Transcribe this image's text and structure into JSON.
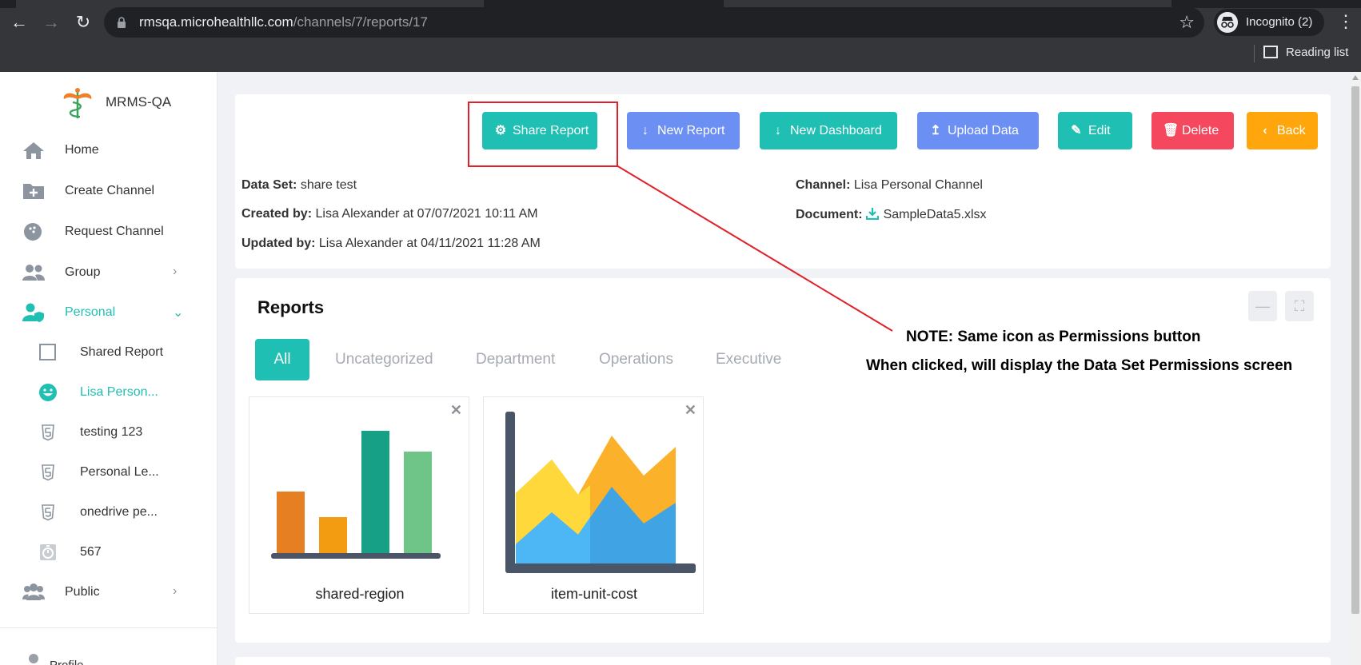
{
  "browser": {
    "url_host": "rmsqa.microhealthllc.com",
    "url_path": "/channels/7/reports/17",
    "profile_label": "Incognito (2)",
    "reading_list_label": "Reading list"
  },
  "sidebar": {
    "brand": "MRMS-QA",
    "items": [
      {
        "label": "Home",
        "icon": "home-icon"
      },
      {
        "label": "Create Channel",
        "icon": "folder-plus-icon"
      },
      {
        "label": "Request Channel",
        "icon": "bowling-ball-icon"
      },
      {
        "label": "Group",
        "icon": "users-icon"
      },
      {
        "label": "Personal",
        "icon": "user-shield-icon"
      },
      {
        "label": "Public",
        "icon": "users-icon"
      }
    ],
    "personal_items": [
      {
        "label": "Shared Report",
        "icon": "square-icon"
      },
      {
        "label": "Lisa Person...",
        "icon": "smile-icon"
      },
      {
        "label": "testing 123",
        "icon": "html5-icon"
      },
      {
        "label": "Personal Le...",
        "icon": "html5-icon"
      },
      {
        "label": "onedrive pe...",
        "icon": "html5-icon"
      },
      {
        "label": "567",
        "icon": "stopwatch-icon"
      }
    ],
    "profile_label": "Profile"
  },
  "toolbar": {
    "share_report": "Share Report",
    "new_report": "New Report",
    "new_dashboard": "New Dashboard",
    "upload_data": "Upload Data",
    "edit": "Edit",
    "delete": "Delete",
    "back": "Back"
  },
  "meta": {
    "data_set_label": "Data Set:",
    "data_set_value": "share test",
    "created_by_label": "Created by:",
    "created_by_value": "Lisa Alexander at 07/07/2021 10:11 AM",
    "updated_by_label": "Updated by:",
    "updated_by_value": "Lisa Alexander at 04/11/2021 11:28 AM",
    "channel_label": "Channel:",
    "channel_value": "Lisa Personal Channel",
    "document_label": "Document:",
    "document_value": "SampleData5.xlsx"
  },
  "reports": {
    "title": "Reports",
    "tabs": [
      "All",
      "Uncategorized",
      "Department",
      "Operations",
      "Executive"
    ],
    "tiles": [
      {
        "caption": "shared-region",
        "icon": "bar-chart-icon"
      },
      {
        "caption": "item-unit-cost",
        "icon": "area-chart-icon"
      }
    ]
  },
  "annotation": {
    "line1": "NOTE: Same icon as Permissions button",
    "line2": "When clicked, will display the Data Set Permissions screen"
  },
  "colors": {
    "teal": "#1fbfb3",
    "blue": "#6c8ff4",
    "red": "#f5475e",
    "orange": "#ffa60d",
    "annotation_red": "#e0202a"
  }
}
